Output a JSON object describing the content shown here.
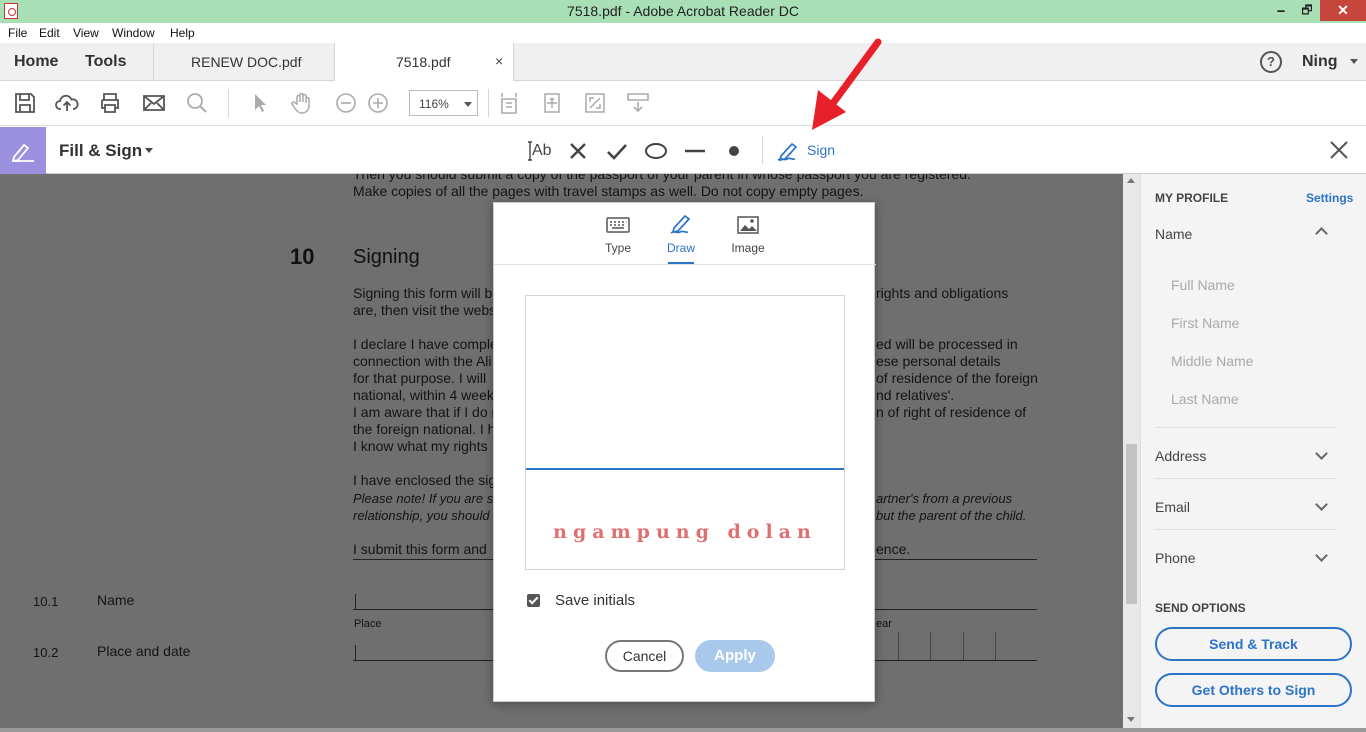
{
  "window": {
    "title": "7518.pdf - Adobe Acrobat Reader DC",
    "minimize": "🗕",
    "maximize": "🗗",
    "close": "✕"
  },
  "menu": [
    "File",
    "Edit",
    "View",
    "Window",
    "Help"
  ],
  "tabs": {
    "home": "Home",
    "tools": "Tools",
    "documents": [
      {
        "label": "RENEW DOC.pdf"
      },
      {
        "label": "7518.pdf",
        "close": "×"
      }
    ],
    "help": "?",
    "user": "Ning"
  },
  "toolbar": {
    "zoom": "116%"
  },
  "fill_sign": {
    "title": "Fill & Sign",
    "text_tool": "Ab",
    "sign_label": "Sign"
  },
  "document": {
    "lines_top": [
      "Then you should submit a copy of the passport of your parent in whose passport you are registered.",
      "Make copies of all the pages with travel stamps as well. Do not copy empty pages."
    ],
    "section_number": "10",
    "section_title": "Signing",
    "para1_left": [
      "Signing this form will b",
      "are, then visit the webs"
    ],
    "para1_right": [
      "rights and obligations"
    ],
    "para2_left": [
      "I declare I have comple",
      "connection with the Ali",
      "for that purpose. I will",
      "national, within 4 week",
      "I am aware that if I do r",
      "the foreign national. I h",
      "I know what my rights"
    ],
    "para2_right": [
      "ed will be processed in",
      "ese personal details",
      "of residence of the foreign",
      "nd relatives'.",
      "n of right of residence of"
    ],
    "para3_left": "I have enclosed the sig",
    "note_left": [
      "Please note! If you are sub",
      "relationship, you should n"
    ],
    "note_right": [
      "artner's from a previous",
      "but the parent of the child."
    ],
    "submit_left": "I submit this form and",
    "submit_right": "ence.",
    "field1_num": "10.1",
    "field1_label": "Name",
    "field2_num": "10.2",
    "field2_label": "Place and date",
    "place_label": "Place",
    "year_label": "ear"
  },
  "right_panel": {
    "my_profile": "MY PROFILE",
    "settings": "Settings",
    "name": "Name",
    "name_fields": [
      "Full Name",
      "First Name",
      "Middle Name",
      "Last Name"
    ],
    "address": "Address",
    "email": "Email",
    "phone": "Phone",
    "send_options": "SEND OPTIONS",
    "send_track": "Send & Track",
    "get_others": "Get Others to Sign"
  },
  "dialog": {
    "tabs": [
      {
        "label": "Type",
        "icon": "keyboard-icon"
      },
      {
        "label": "Draw",
        "icon": "pen-icon",
        "active": true
      },
      {
        "label": "Image",
        "icon": "image-icon"
      }
    ],
    "signature": "ngampung dolan",
    "save_initials": "Save initials",
    "save_initials_checked": true,
    "cancel": "Cancel",
    "apply": "Apply"
  }
}
